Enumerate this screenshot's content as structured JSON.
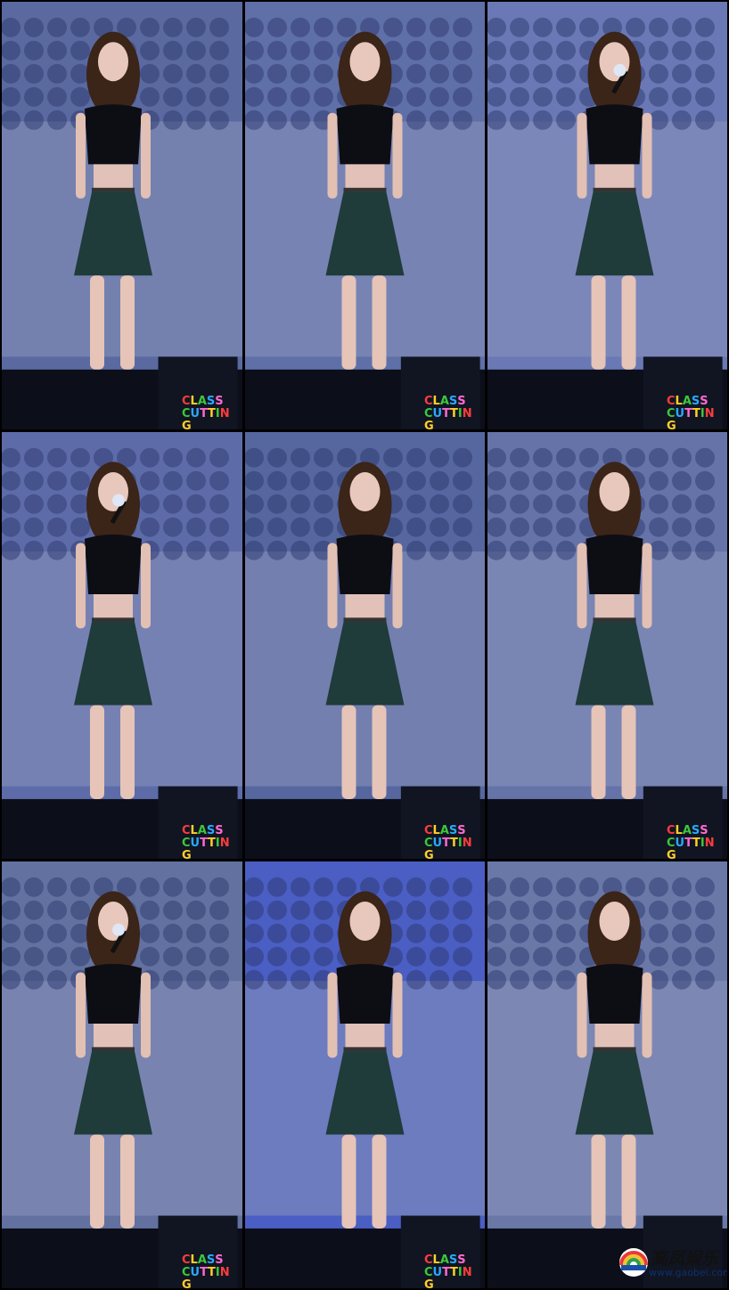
{
  "panels": [
    {
      "id": 1,
      "pose": "standing",
      "bg": "#5a6aa0"
    },
    {
      "id": 2,
      "pose": "standing",
      "bg": "#5f6fa8"
    },
    {
      "id": 3,
      "pose": "singing",
      "bg": "#6a79b5"
    },
    {
      "id": 4,
      "pose": "singing",
      "bg": "#5d6ca9"
    },
    {
      "id": 5,
      "pose": "dancing",
      "bg": "#56669f"
    },
    {
      "id": 6,
      "pose": "bending",
      "bg": "#6573a8"
    },
    {
      "id": 7,
      "pose": "singing",
      "bg": "#62719f"
    },
    {
      "id": 8,
      "pose": "dancing",
      "bg": "#4a5ec4"
    },
    {
      "id": 9,
      "pose": "standing",
      "bg": "#6a78a8"
    }
  ],
  "watermark": {
    "line1": [
      "C",
      "L",
      "A",
      "S",
      "S"
    ],
    "line2": [
      "C",
      "U",
      "T",
      "T",
      "I",
      "N",
      "G"
    ],
    "colors": [
      "#ff3c3c",
      "#ffd02a",
      "#3cc83c",
      "#2aa8ff",
      "#ff6ad0",
      "#ffd02a",
      "#3cc83c"
    ]
  },
  "corner_logo": {
    "name": "高凤娱乐",
    "url": "www.gaobei.com"
  }
}
